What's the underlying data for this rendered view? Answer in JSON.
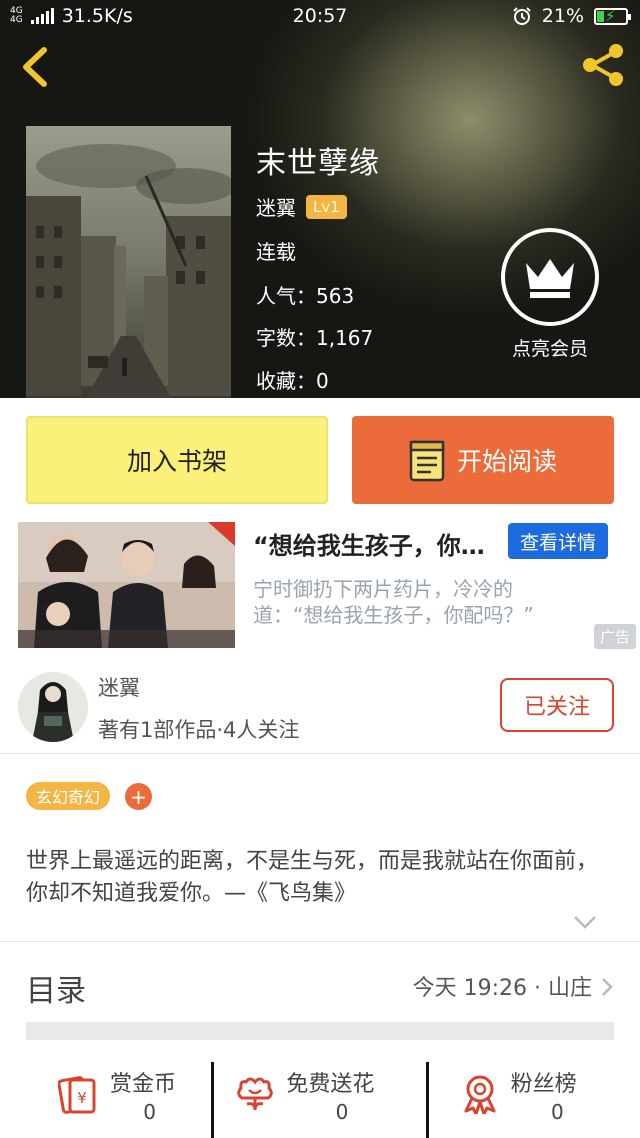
{
  "status_bar": {
    "network_top": "4G",
    "network_bottom": "4G",
    "speed": "31.5K/s",
    "time": "20:57",
    "battery": "21%"
  },
  "book": {
    "title": "末世孽缘",
    "author": "迷翼",
    "level": "Lv1",
    "status": "连载",
    "popularity": "人气：563",
    "word_count": "字数：1,167",
    "favorites": "收藏：0"
  },
  "vip": {
    "label": "点亮会员"
  },
  "actions": {
    "add_shelf": "加入书架",
    "start_reading": "开始阅读"
  },
  "ad": {
    "title": "“想给我生孩子，你…",
    "button": "查看详情",
    "description": "宁时御扔下两片药片，冷冷的道：“想给我生孩子，你配吗？”",
    "tag": "广告"
  },
  "author_card": {
    "name": "迷翼",
    "info": "著有1部作品·4人关注",
    "follow": "已关注"
  },
  "tags": [
    "玄幻奇幻"
  ],
  "tag_add": "+",
  "synopsis": "世界上最遥远的距离，不是生与死，而是我就站在你面前，你却不知道我爱你。—《飞鸟集》",
  "catalog": {
    "label": "目录",
    "latest": "今天 19:26 · 山庄"
  },
  "stats": [
    {
      "label": "赏金币",
      "value": "0",
      "icon": "coin-envelope-icon"
    },
    {
      "label": "免费送花",
      "value": "0",
      "icon": "flower-icon"
    },
    {
      "label": "粉丝榜",
      "value": "0",
      "icon": "medal-icon"
    }
  ],
  "colors": {
    "accent_orange": "#ec6b3b",
    "shelf_yellow": "#fbf07a",
    "badge_gold": "#f3b544",
    "follow_red": "#d9432f",
    "ad_blue": "#1c6ce0"
  }
}
